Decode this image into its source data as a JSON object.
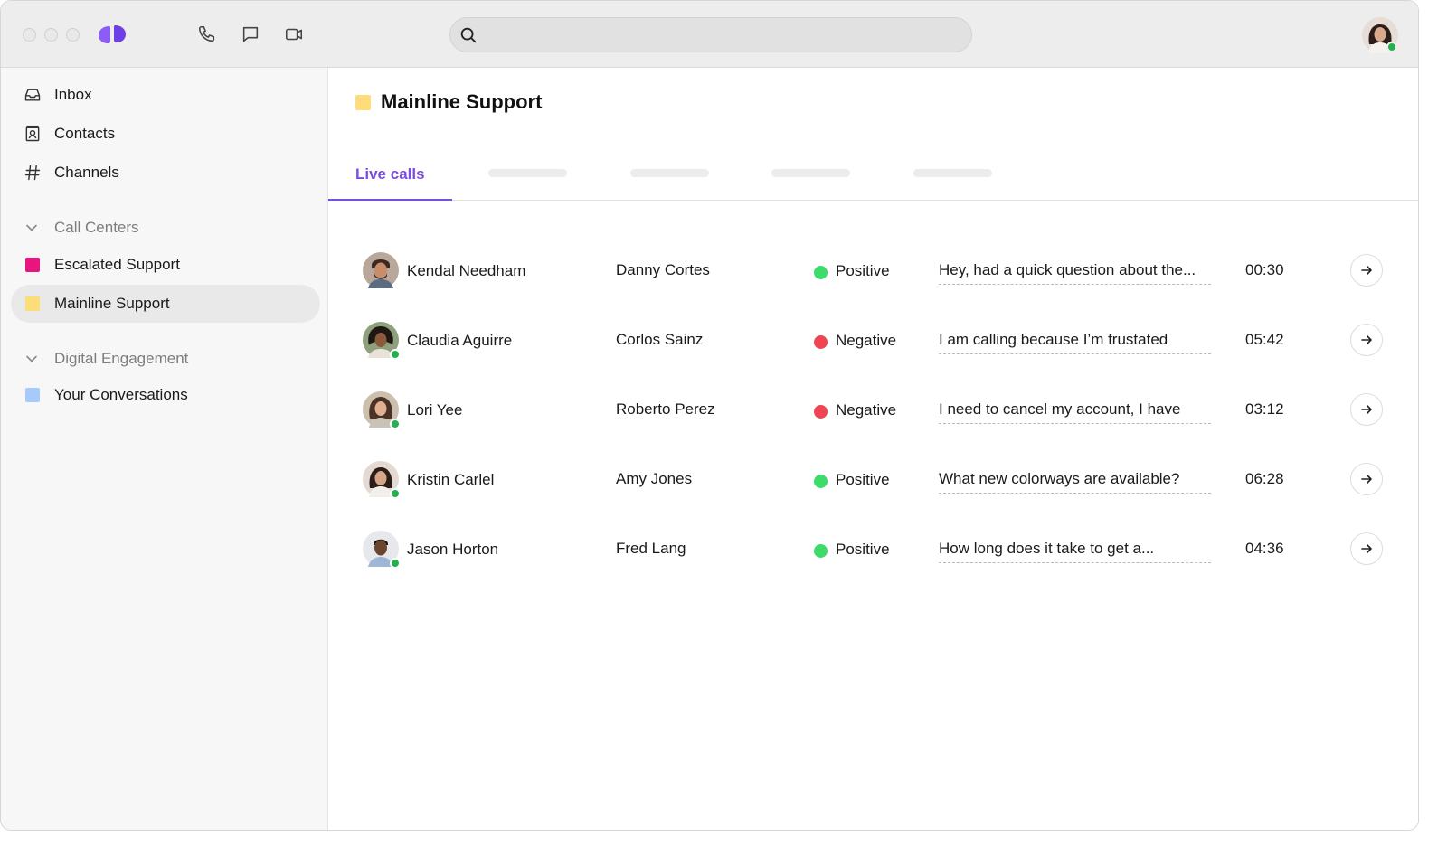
{
  "search": {
    "placeholder": ""
  },
  "sidebar": {
    "items": [
      {
        "label": "Inbox",
        "icon": "inbox-icon"
      },
      {
        "label": "Contacts",
        "icon": "contacts-icon"
      },
      {
        "label": "Channels",
        "icon": "hash-icon"
      }
    ],
    "sections": [
      {
        "label": "Call Centers",
        "items": [
          {
            "label": "Escalated Support",
            "color": "#e8157f"
          },
          {
            "label": "Mainline Support",
            "color": "#fddc7a",
            "active": true
          }
        ]
      },
      {
        "label": "Digital Engagement",
        "items": [
          {
            "label": "Your Conversations",
            "color": "#a6cbfb"
          }
        ]
      }
    ]
  },
  "main": {
    "title": "Mainline Support",
    "title_color": "#fddc7a",
    "tabs": [
      {
        "label": "Live calls",
        "active": true
      }
    ],
    "accent": "#7b4ce0",
    "calls": [
      {
        "agent": "Kendal Needham",
        "caller": "Danny Cortes",
        "sentiment": "Positive",
        "sentiment_color": "#3ddb6a",
        "snippet": "Hey, had a quick question about the...",
        "duration": "00:30",
        "presence": false
      },
      {
        "agent": "Claudia Aguirre",
        "caller": "Corlos Sainz",
        "sentiment": "Negative",
        "sentiment_color": "#ef4452",
        "snippet": "I am calling because I’m frustated",
        "duration": "05:42",
        "presence": true
      },
      {
        "agent": "Lori Yee",
        "caller": "Roberto Perez",
        "sentiment": "Negative",
        "sentiment_color": "#ef4452",
        "snippet": "I need to cancel my account, I have",
        "duration": "03:12",
        "presence": true
      },
      {
        "agent": "Kristin Carlel",
        "caller": "Amy Jones",
        "sentiment": "Positive",
        "sentiment_color": "#3ddb6a",
        "snippet": "What new colorways are available?",
        "duration": "06:28",
        "presence": true
      },
      {
        "agent": "Jason Horton",
        "caller": "Fred Lang",
        "sentiment": "Positive",
        "sentiment_color": "#3ddb6a",
        "snippet": "How long does it take to get a...",
        "duration": "04:36",
        "presence": true
      }
    ]
  }
}
